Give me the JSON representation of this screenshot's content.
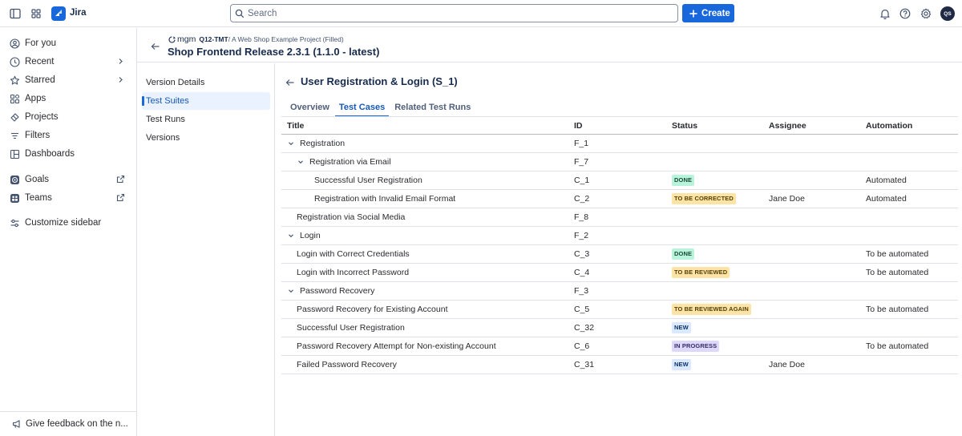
{
  "topbar": {
    "app_name": "Jira",
    "search_placeholder": "Search",
    "create_label": "Create",
    "avatar_initials": "QS",
    "brand_color": "#1868db"
  },
  "sidebar": {
    "items": [
      {
        "label": "For you",
        "icon": "person-circle-icon"
      },
      {
        "label": "Recent",
        "icon": "clock-icon"
      },
      {
        "label": "Starred",
        "icon": "star-icon"
      },
      {
        "label": "Apps",
        "icon": "apps-icon"
      },
      {
        "label": "Projects",
        "icon": "projects-icon"
      },
      {
        "label": "Filters",
        "icon": "filter-icon"
      },
      {
        "label": "Dashboards",
        "icon": "dashboard-icon"
      },
      {
        "label": "Goals",
        "icon": "goals-icon"
      },
      {
        "label": "Teams",
        "icon": "teams-icon"
      },
      {
        "label": "Customize sidebar",
        "icon": "customize-icon"
      }
    ],
    "feedback_label": "Give feedback on the n..."
  },
  "header": {
    "app_tag": "mgm",
    "project_key": "Q12-TMT",
    "project_path": "/ A Web Shop Example Project (Filled)",
    "release_title": "Shop Frontend Release 2.3.1 (1.1.0 - latest)"
  },
  "subnav": {
    "items": [
      {
        "label": "Version Details",
        "active": false
      },
      {
        "label": "Test Suites",
        "active": true
      },
      {
        "label": "Test Runs",
        "active": false
      },
      {
        "label": "Versions",
        "active": false
      }
    ]
  },
  "main": {
    "title": "User Registration & Login (S_1)",
    "tabs": [
      {
        "label": "Overview",
        "active": false
      },
      {
        "label": "Test Cases",
        "active": true
      },
      {
        "label": "Related Test Runs",
        "active": false
      }
    ],
    "columns": {
      "title": "Title",
      "id": "ID",
      "status": "Status",
      "assignee": "Assignee",
      "automation": "Automation"
    },
    "rows": [
      {
        "title": "Registration",
        "id": "F_1",
        "status": "",
        "status_kind": "",
        "assignee": "",
        "automation": "",
        "depth": 1,
        "folder": true
      },
      {
        "title": "Registration via Email",
        "id": "F_7",
        "status": "",
        "status_kind": "",
        "assignee": "",
        "automation": "",
        "depth": 2,
        "folder": true
      },
      {
        "title": "Successful User Registration",
        "id": "C_1",
        "status": "DONE",
        "status_kind": "done",
        "assignee": "",
        "automation": "Automated",
        "depth": 3,
        "folder": false
      },
      {
        "title": "Registration with Invalid Email Format",
        "id": "C_2",
        "status": "TO BE CORRECTED",
        "status_kind": "warn",
        "assignee": "Jane Doe",
        "automation": "Automated",
        "depth": 3,
        "folder": false
      },
      {
        "title": "Registration via Social Media",
        "id": "F_8",
        "status": "",
        "status_kind": "",
        "assignee": "",
        "automation": "",
        "depth": 2,
        "folder": false
      },
      {
        "title": "Login",
        "id": "F_2",
        "status": "",
        "status_kind": "",
        "assignee": "",
        "automation": "",
        "depth": 1,
        "folder": true
      },
      {
        "title": "Login with Correct Credentials",
        "id": "C_3",
        "status": "DONE",
        "status_kind": "done",
        "assignee": "",
        "automation": "To be automated",
        "depth": 2,
        "folder": false
      },
      {
        "title": "Login with Incorrect Password",
        "id": "C_4",
        "status": "TO BE REVIEWED",
        "status_kind": "warn",
        "assignee": "",
        "automation": "To be automated",
        "depth": 2,
        "folder": false
      },
      {
        "title": "Password Recovery",
        "id": "F_3",
        "status": "",
        "status_kind": "",
        "assignee": "",
        "automation": "",
        "depth": 1,
        "folder": true
      },
      {
        "title": "Password Recovery for Existing Account",
        "id": "C_5",
        "status": "TO BE REVIEWED AGAIN",
        "status_kind": "warn",
        "assignee": "",
        "automation": "To be automated",
        "depth": 2,
        "folder": false
      },
      {
        "title": "Successful User Registration",
        "id": "C_32",
        "status": "NEW",
        "status_kind": "new",
        "assignee": "",
        "automation": "",
        "depth": 2,
        "folder": false
      },
      {
        "title": "Password Recovery Attempt for Non-existing Account",
        "id": "C_6",
        "status": "IN PROGRESS",
        "status_kind": "prog",
        "assignee": "",
        "automation": "To be automated",
        "depth": 2,
        "folder": false
      },
      {
        "title": "Failed Password Recovery",
        "id": "C_31",
        "status": "NEW",
        "status_kind": "new",
        "assignee": "Jane Doe",
        "automation": "",
        "depth": 2,
        "folder": false
      }
    ]
  }
}
